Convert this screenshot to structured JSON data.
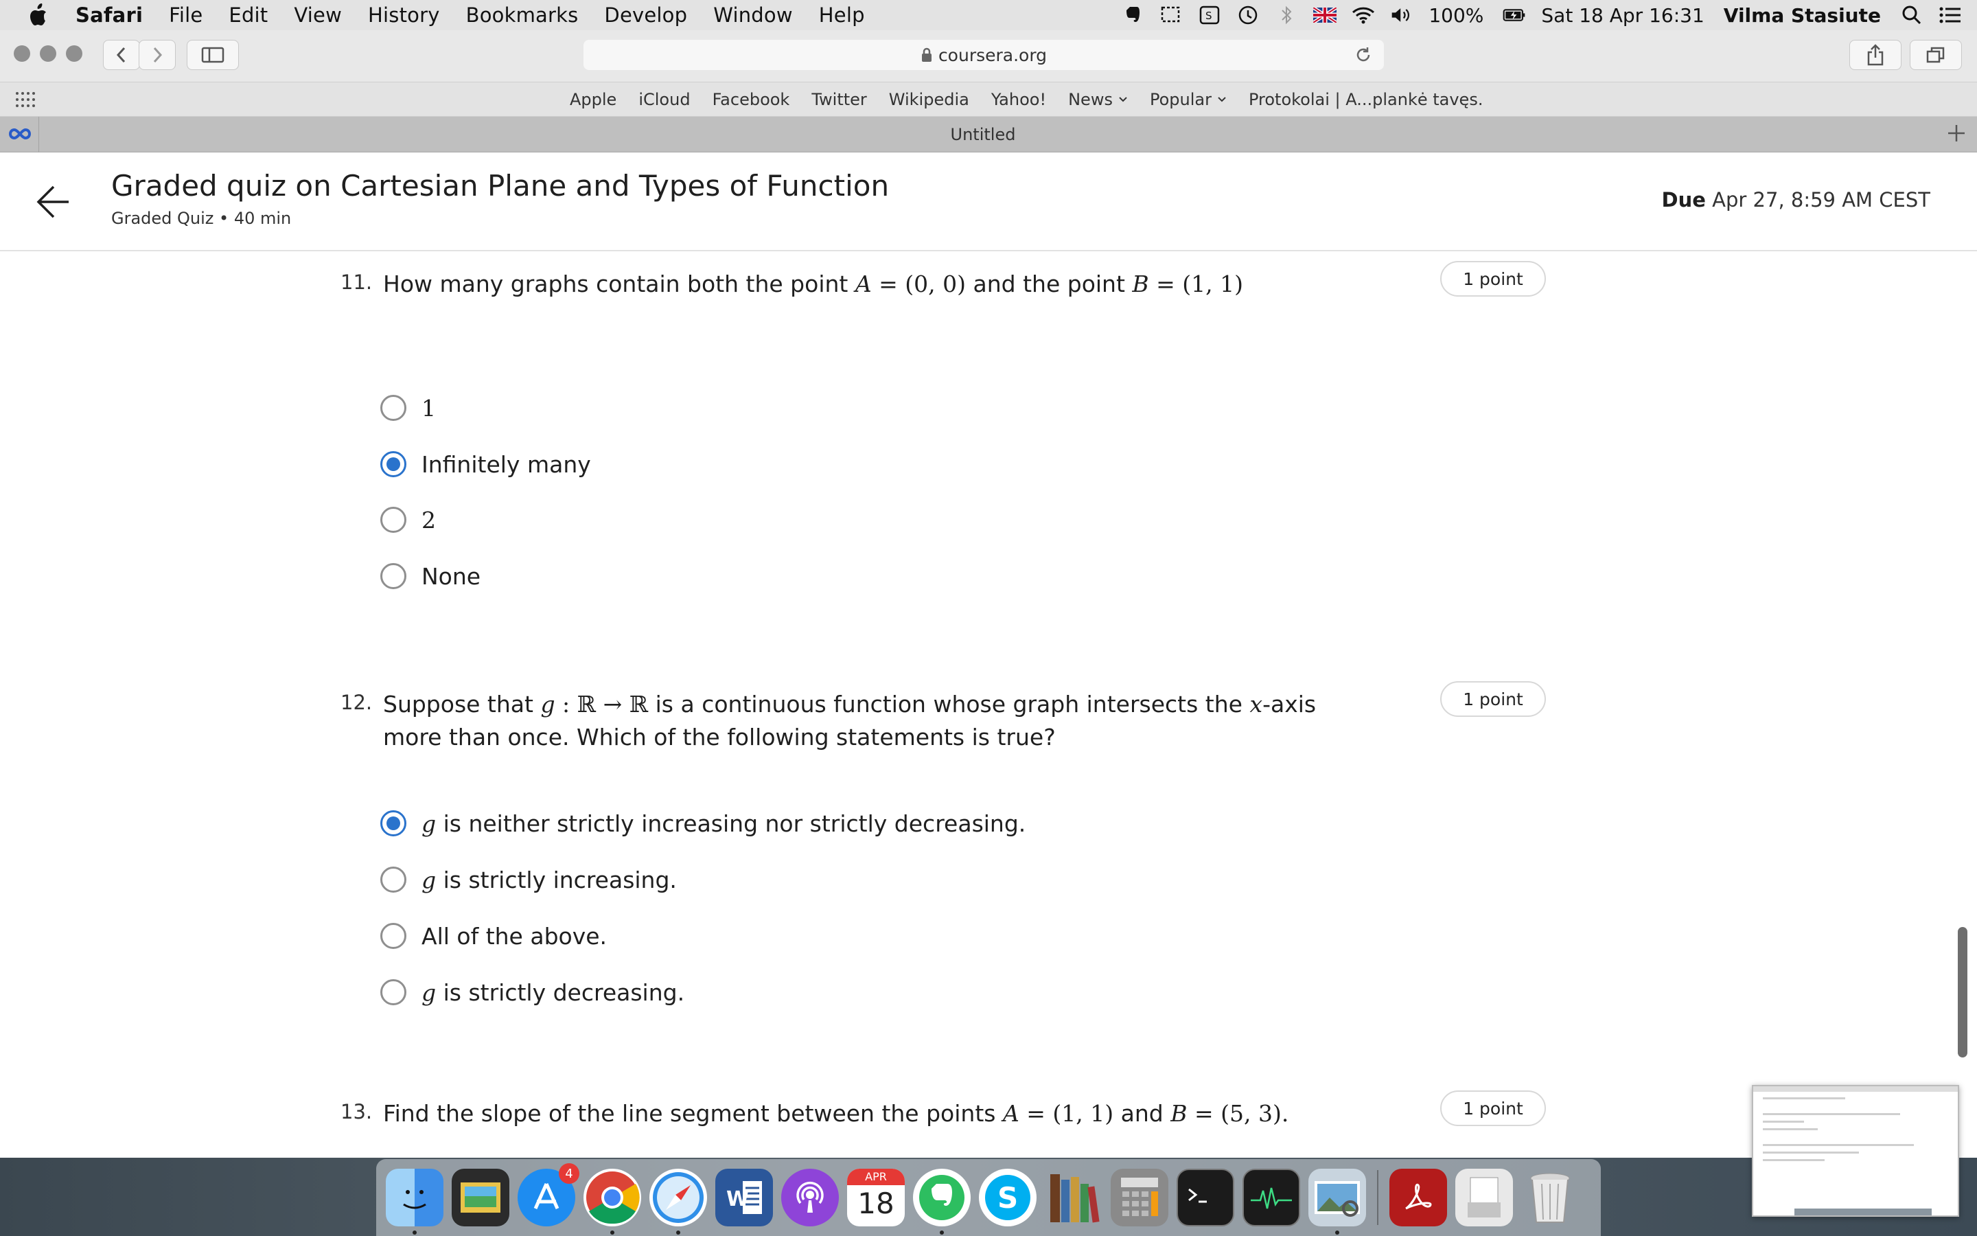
{
  "menubar": {
    "app_name": "Safari",
    "items": [
      "File",
      "Edit",
      "View",
      "History",
      "Bookmarks",
      "Develop",
      "Window",
      "Help"
    ],
    "battery": "100%",
    "datetime": "Sat 18 Apr  16:31",
    "user": "Vilma Stasiute"
  },
  "browser": {
    "url": "coursera.org",
    "favorites": [
      "Apple",
      "iCloud",
      "Facebook",
      "Twitter",
      "Wikipedia",
      "Yahoo!",
      "News",
      "Popular",
      "Protokolai | A...plankė tavęs."
    ],
    "tab_title": "Untitled"
  },
  "header": {
    "title": "Graded quiz on Cartesian Plane and Types of Function",
    "subtitle": "Graded Quiz • 40 min",
    "due_label": "Due",
    "due_value": "Apr 27, 8:59 AM CEST"
  },
  "questions": [
    {
      "number": "11.",
      "text_a": "How many graphs contain both the point ",
      "math_a": "A",
      "text_b": " = (0, 0)",
      "text_c": " and the point ",
      "math_b": "B",
      "text_d": " = (1, 1)",
      "points": "1 point",
      "options": [
        {
          "label": "1",
          "checked": false
        },
        {
          "label": "Infinitely many",
          "checked": true
        },
        {
          "label": "2",
          "checked": false
        },
        {
          "label": "None",
          "checked": false
        }
      ]
    },
    {
      "number": "12.",
      "text_a": "Suppose that ",
      "math_a": "g",
      "text_b": " : ℝ → ℝ",
      "text_c": " is a continuous function whose graph intersects the ",
      "math_b": "x",
      "text_d": "-axis more than once. Which of the following statements is true?",
      "points": "1 point",
      "options": [
        {
          "math": "g",
          "label": " is neither strictly increasing nor strictly decreasing.",
          "checked": true
        },
        {
          "math": "g",
          "label": " is strictly increasing.",
          "checked": false
        },
        {
          "math": "",
          "label": "All of the above.",
          "checked": false
        },
        {
          "math": "g",
          "label": " is strictly decreasing.",
          "checked": false
        }
      ]
    },
    {
      "number": "13.",
      "text_a": "Find the slope of the line segment between the points ",
      "math_a": "A",
      "text_b": " = (1, 1)",
      "text_c": " and ",
      "math_b": "B",
      "text_d": " = (5, 3).",
      "points": "1 point"
    }
  ],
  "dock": {
    "app_store_badge": "4",
    "calendar_month": "APR",
    "calendar_day": "18"
  },
  "colors": {
    "accent": "#2a73cc",
    "radio_border": "#8f8f8f"
  }
}
